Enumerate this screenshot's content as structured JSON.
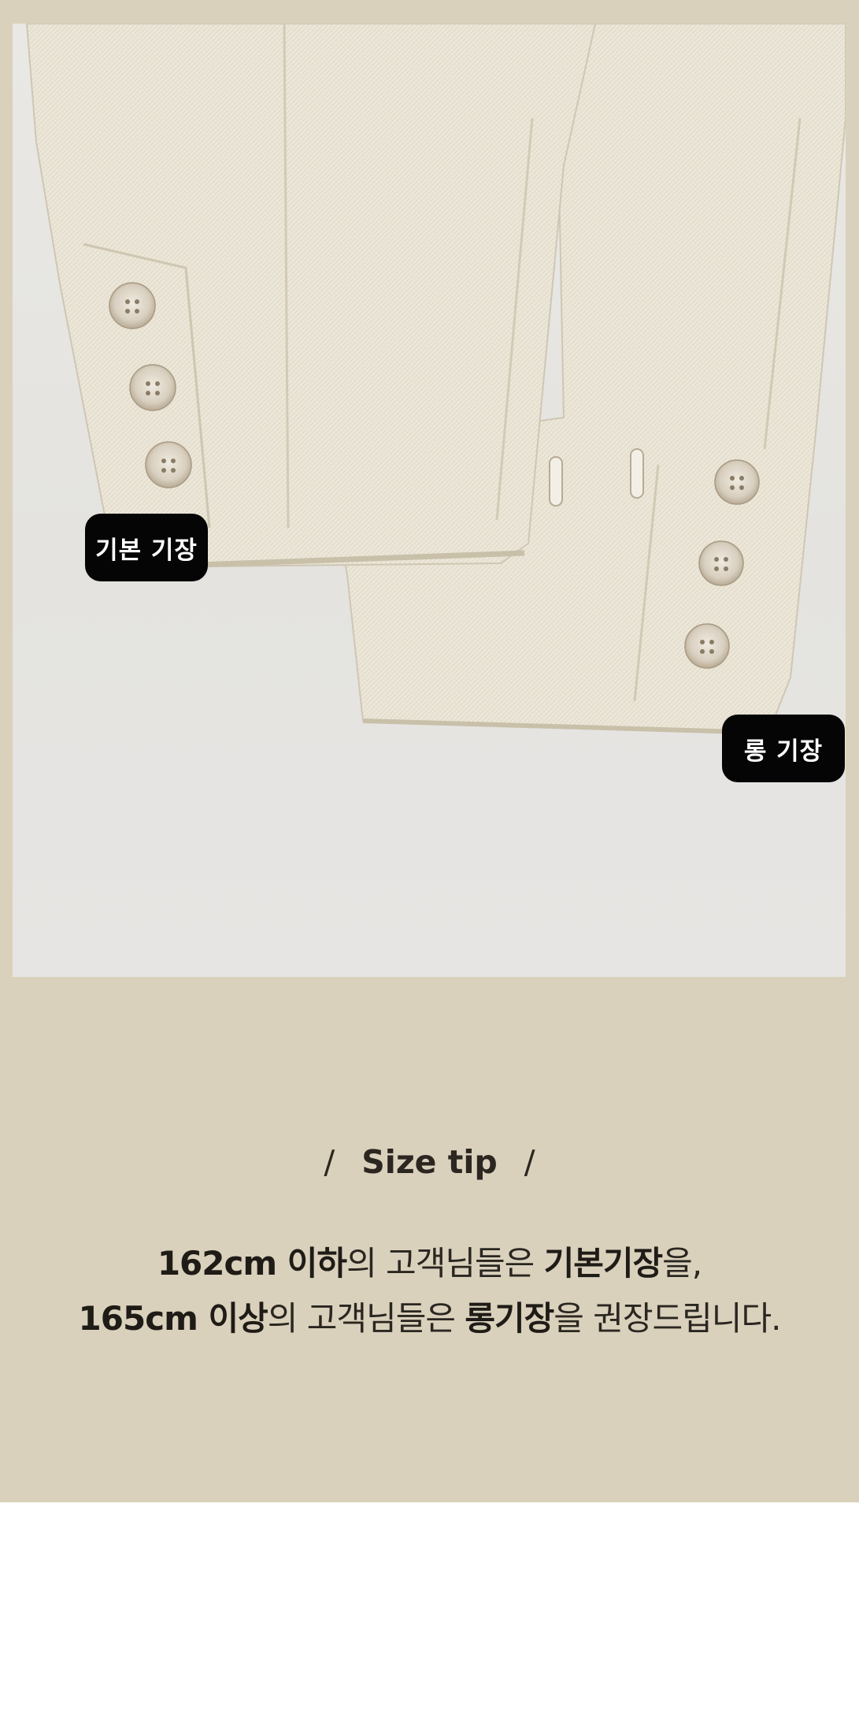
{
  "photo": {
    "tags": {
      "basic": "기본 기장",
      "long": "롱 기장"
    }
  },
  "size_tip": {
    "slash_left": "/",
    "title": "Size tip",
    "slash_right": "/",
    "line1": {
      "height": "162cm 이하",
      "mid": "의 고객님들은 ",
      "length": "기본기장",
      "end": "을,"
    },
    "line2": {
      "height": "165cm 이상",
      "mid": "의 고객님들은 ",
      "length": "롱기장",
      "end": "을 권장드립니다."
    }
  },
  "colors": {
    "background_band": "#d9d1bc",
    "fabric": "#ece7d9",
    "tag_background": "#050505",
    "tag_text": "#ffffff"
  }
}
